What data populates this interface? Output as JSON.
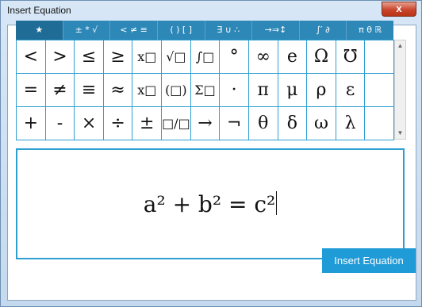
{
  "window": {
    "title": "Insert Equation",
    "close_label": "x"
  },
  "tabs": [
    {
      "label": "★"
    },
    {
      "label": "± * √"
    },
    {
      "label": "< ≠ ≡"
    },
    {
      "label": "( ) [ ]"
    },
    {
      "label": "∃ ∪ ∴"
    },
    {
      "label": "→⇒↕"
    },
    {
      "label": "∫′ ∂"
    },
    {
      "label": "π θ ℝ"
    }
  ],
  "symbols": [
    [
      "<",
      ">",
      "≤",
      "≥",
      "x□",
      "√□",
      "∫□",
      "°",
      "∞",
      "e",
      "Ω",
      "℧"
    ],
    [
      "=",
      "≠",
      "≡",
      "≈",
      "x□",
      "(□)",
      "Σ□",
      "·",
      "π",
      "μ",
      "ρ",
      "ε"
    ],
    [
      "+",
      "-",
      "×",
      "÷",
      "±",
      "□/□",
      "→",
      "¬",
      "θ",
      "δ",
      "ω",
      "λ"
    ]
  ],
  "editor": {
    "equation": "a² + b² = c²"
  },
  "insert_button": {
    "label": "Insert Equation"
  },
  "colors": {
    "accent": "#2e9fd2",
    "tab_bg": "#2d88b8",
    "button_bg": "#1f9bd7"
  }
}
